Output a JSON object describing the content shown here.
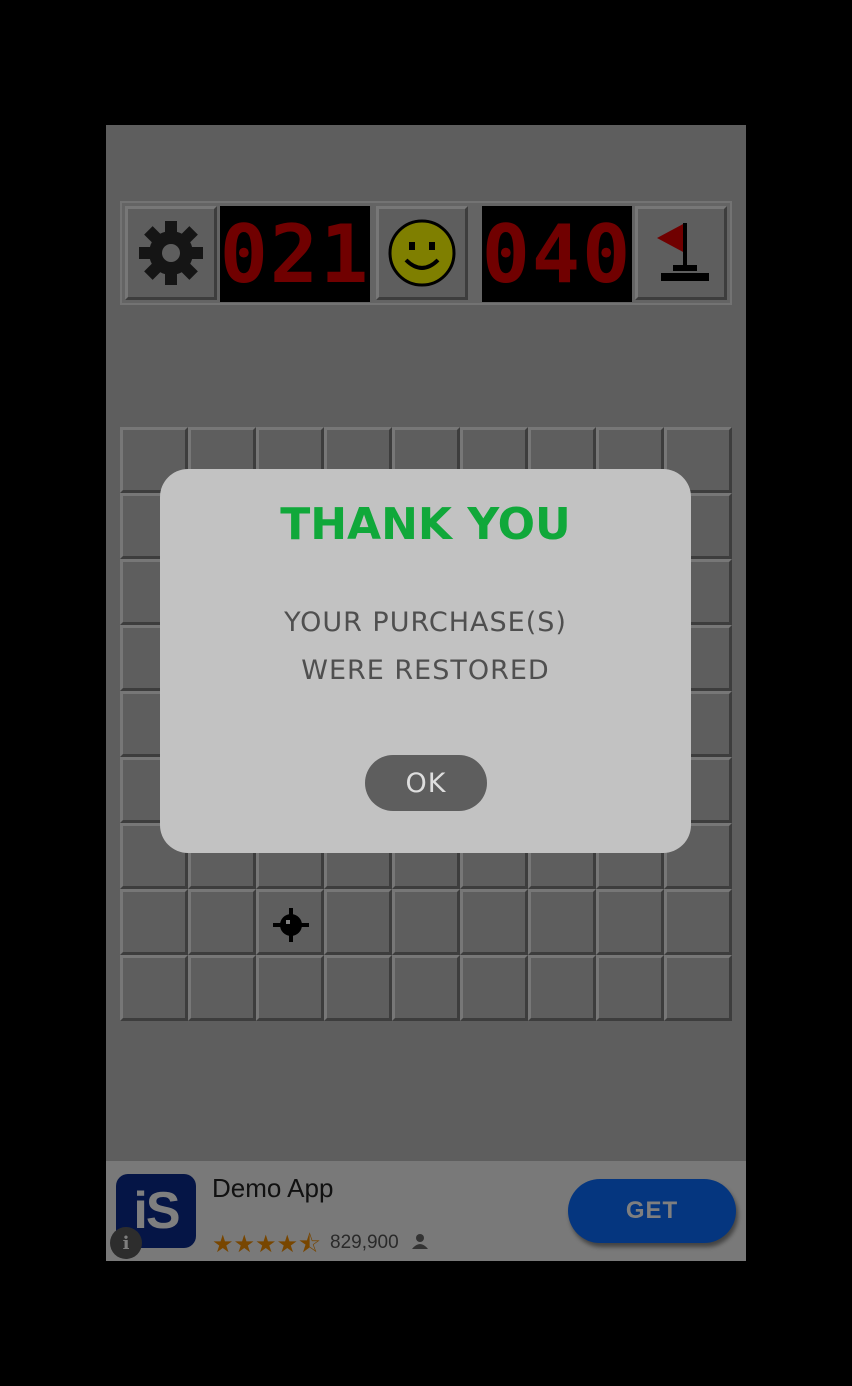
{
  "header": {
    "mine_counter": "021",
    "timer": "040",
    "settings_icon": "gear-icon",
    "face_icon": "smiley-face-icon",
    "flag_icon": "flag-icon"
  },
  "board": {
    "rows": 9,
    "cols": 9,
    "visible_mine": {
      "row": 7,
      "col": 2
    }
  },
  "ad": {
    "app_name": "Demo App",
    "logo_text": "iS",
    "rating_stars": "★★★★⯪",
    "rating_count": "829,900",
    "cta_label": "GET",
    "info_label": "i"
  },
  "dialog": {
    "title": "THANK YOU",
    "line1": "YOUR PURCHASE(S)",
    "line2": "WERE RESTORED",
    "ok_label": "OK",
    "title_color": "#10a83a"
  },
  "colors": {
    "lcd_digits": "#e00000",
    "cta": "#0a6cff",
    "stars": "#f08c00"
  }
}
